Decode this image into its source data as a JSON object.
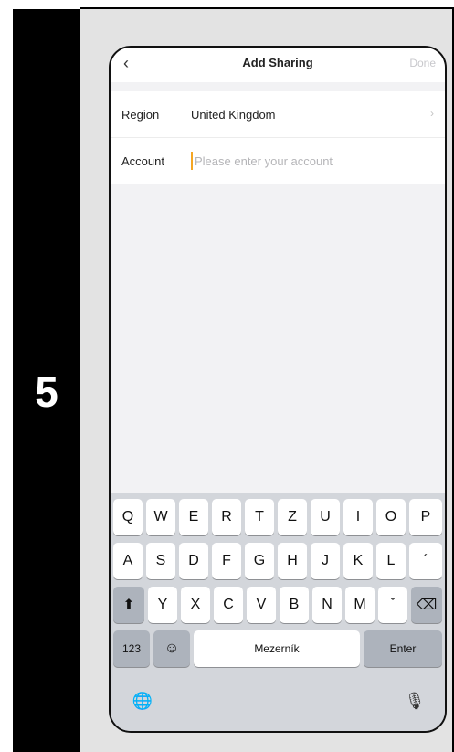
{
  "step": {
    "number": "5"
  },
  "nav": {
    "back_icon": "‹",
    "title": "Add Sharing",
    "done_label": "Done"
  },
  "form": {
    "region_label": "Region",
    "region_value": "United Kingdom",
    "chevron_icon": "›",
    "account_label": "Account",
    "account_placeholder": "Please enter your account",
    "account_value": ""
  },
  "keyboard": {
    "row1": [
      "Q",
      "W",
      "E",
      "R",
      "T",
      "Z",
      "U",
      "I",
      "O",
      "P"
    ],
    "row2": [
      "A",
      "S",
      "D",
      "F",
      "G",
      "H",
      "J",
      "K",
      "L",
      "´"
    ],
    "row3": [
      "Y",
      "X",
      "C",
      "V",
      "B",
      "N",
      "M",
      "ˇ"
    ],
    "shift_icon": "⬆",
    "backspace_icon": "⌫",
    "numbers_label": "123",
    "emoji_icon": "☺",
    "space_label": "Mezerník",
    "enter_label": "Enter",
    "globe_icon": "🌐",
    "mic_icon": "🎙"
  },
  "colors": {
    "cursor": "#f5a623",
    "placeholder": "#b5b5b8",
    "done_disabled": "#c8c8cc"
  }
}
